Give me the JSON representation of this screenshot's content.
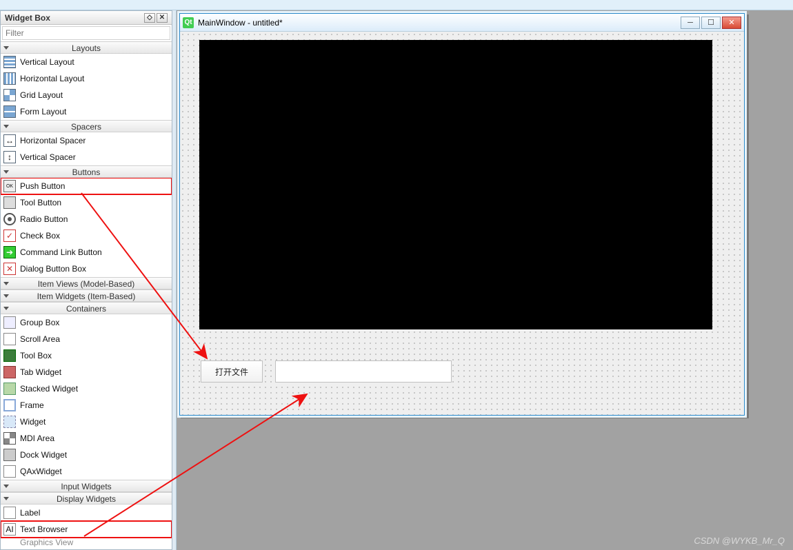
{
  "panel": {
    "title": "Widget Box",
    "filter_placeholder": "Filter",
    "float_btn": "◇",
    "close_btn": "✕"
  },
  "cats": {
    "layouts": "Layouts",
    "spacers": "Spacers",
    "buttons": "Buttons",
    "itemviews": "Item Views (Model-Based)",
    "itemwidgets": "Item Widgets (Item-Based)",
    "containers": "Containers",
    "inputwidgets": "Input Widgets",
    "displaywidgets": "Display Widgets"
  },
  "items": {
    "vlayout": "Vertical Layout",
    "hlayout": "Horizontal Layout",
    "gridlayout": "Grid Layout",
    "formlayout": "Form Layout",
    "hspacer": "Horizontal Spacer",
    "vspacer": "Vertical Spacer",
    "pushbutton": "Push Button",
    "toolbutton": "Tool Button",
    "radiobutton": "Radio Button",
    "checkbox": "Check Box",
    "cmdlink": "Command Link Button",
    "dbb": "Dialog Button Box",
    "groupbox": "Group Box",
    "scrollarea": "Scroll Area",
    "toolbox": "Tool Box",
    "tabwidget": "Tab Widget",
    "stacked": "Stacked Widget",
    "frame": "Frame",
    "widget": "Widget",
    "mdi": "MDI Area",
    "dock": "Dock Widget",
    "qax": "QAxWidget",
    "label": "Label",
    "textbrowser": "Text Browser",
    "graphicsview": "Graphics View"
  },
  "designer": {
    "window_title": "MainWindow - untitled*",
    "qt_logo": "Qt",
    "open_button": "打开文件",
    "min": "─",
    "max": "☐",
    "close": "✕"
  },
  "watermark": "CSDN @WYKB_Mr_Q"
}
